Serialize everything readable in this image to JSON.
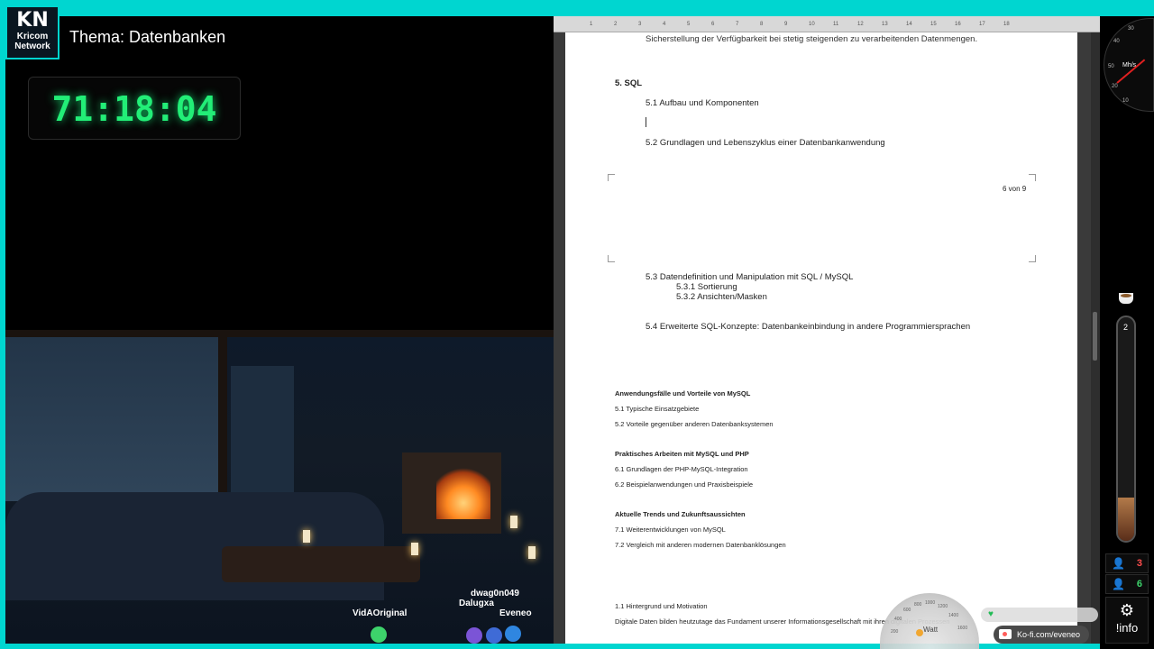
{
  "logo": {
    "big": "KN",
    "line1": "Kricom",
    "line2": "Network"
  },
  "title": "Thema: Datenbanken",
  "timer": "71:18:04",
  "chatters": [
    {
      "name": "VidAOriginal",
      "color": "#3dd36b"
    },
    {
      "name": "dwag0n049",
      "color": "#7b54d6"
    },
    {
      "name": "Dalugxa",
      "color": "#3f6bd6"
    },
    {
      "name": "Eveneo",
      "color": "#2f86e0"
    }
  ],
  "ruler": {
    "ticks": [
      "1",
      "2",
      "3",
      "4",
      "5",
      "6",
      "7",
      "8",
      "9",
      "10",
      "11",
      "12",
      "13",
      "14",
      "15",
      "16",
      "17",
      "18"
    ]
  },
  "document": {
    "page1": {
      "line_top": "Sicherstellung der Verfügbarkeit bei stetig steigenden zu verarbeitenden Datenmengen.",
      "heading": "5. SQL",
      "item1": "5.1 Aufbau und Komponenten",
      "item2": "5.2 Grundlagen und Lebenszyklus einer Datenbankanwendung",
      "page_num": "6 von 9"
    },
    "page2": {
      "item3": "5.3 Datendefinition und Manipulation mit SQL / MySQL",
      "item3a": "5.3.1 Sortierung",
      "item3b": "5.3.2 Ansichten/Masken",
      "item4": "5.4 Erweiterte SQL-Konzepte: Datenbankeinbindung in andere Programmiersprachen",
      "sec1_heading": "Anwendungsfälle und Vorteile von MySQL",
      "sec1_a": "5.1 Typische Einsatzgebiete",
      "sec1_b": "5.2 Vorteile gegenüber anderen Datenbanksystemen",
      "sec2_heading": "Praktisches Arbeiten mit MySQL und PHP",
      "sec2_a": "6.1 Grundlagen der PHP-MySQL-Integration",
      "sec2_b": "6.2 Beispielanwendungen und Praxisbeispiele",
      "sec3_heading": "Aktuelle Trends und Zukunftsaussichten",
      "sec3_a": "7.1 Weiterentwicklungen von MySQL",
      "sec3_b": "7.2 Vergleich mit anderen modernen Datenbanklösungen",
      "sec4_heading": "1.1 Hintergrund und Motivation",
      "para": "Digitale Daten bilden heutzutage das Fundament unserer Informationsgesellschaft mit ihren digitalen Prozessen"
    }
  },
  "gauge": {
    "unit": "Watt",
    "ticks": [
      "200",
      "400",
      "600",
      "800",
      "1000",
      "1200",
      "1400",
      "1600"
    ]
  },
  "kofi": {
    "label": "Ko-fi.com/eveneo"
  },
  "speedo": {
    "unit": "Mh/s",
    "ticks": [
      "30",
      "40",
      "50",
      "20",
      "10"
    ]
  },
  "tube_value": "2",
  "stats": [
    {
      "icon": "user-outline-icon",
      "value": "3",
      "color": "#ff4d4d"
    },
    {
      "icon": "user-green-icon",
      "value": "6",
      "color": "#3dd36b"
    }
  ],
  "info_label": "!info"
}
